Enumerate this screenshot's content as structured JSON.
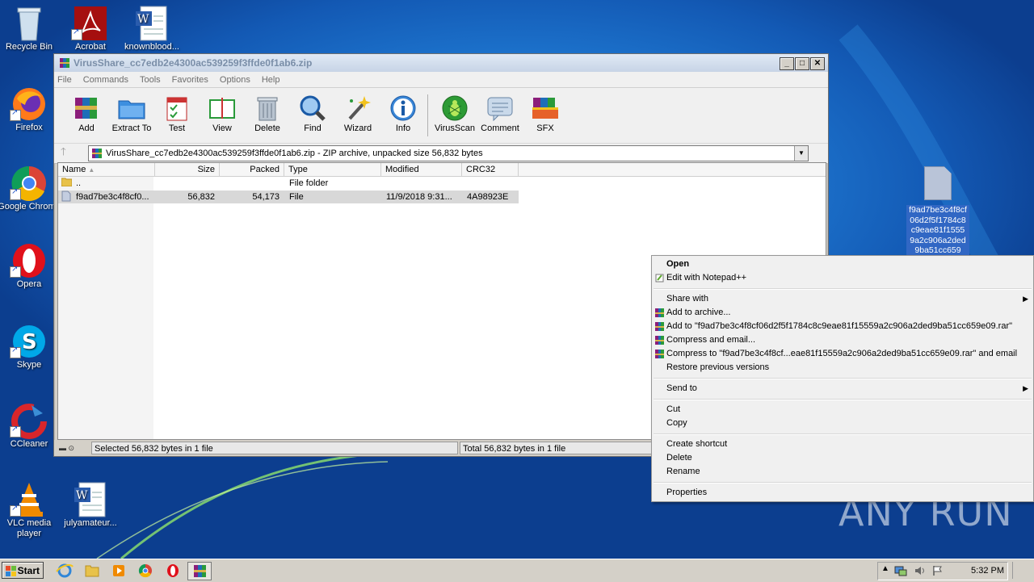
{
  "desktop": {
    "icons": [
      {
        "label": "Recycle Bin"
      },
      {
        "label": "Acrobat"
      },
      {
        "label": "knownblood..."
      },
      {
        "label": "Firefox"
      },
      {
        "label": "Google Chrome"
      },
      {
        "label": "Opera"
      },
      {
        "label": "Skype"
      },
      {
        "label": "CCleaner"
      },
      {
        "label": "VLC media player"
      },
      {
        "label": "julyamateur..."
      }
    ],
    "file_icon_name": "f9ad7be3c4f8cf06d2f5f1784c8c9eae81f15559a2c906a2ded9ba51cc659"
  },
  "window": {
    "title": "VirusShare_cc7edb2e4300ac539259f3ffde0f1ab6.zip",
    "menu": [
      "File",
      "Commands",
      "Tools",
      "Favorites",
      "Options",
      "Help"
    ],
    "toolbar": [
      "Add",
      "Extract To",
      "Test",
      "View",
      "Delete",
      "Find",
      "Wizard",
      "Info",
      "VirusScan",
      "Comment",
      "SFX"
    ],
    "address": "VirusShare_cc7edb2e4300ac539259f3ffde0f1ab6.zip - ZIP archive, unpacked size 56,832 bytes",
    "columns": [
      "Name",
      "Size",
      "Packed",
      "Type",
      "Modified",
      "CRC32"
    ],
    "rows": [
      {
        "name": "..",
        "size": "",
        "packed": "",
        "type": "File folder",
        "modified": "",
        "crc": ""
      },
      {
        "name": "f9ad7be3c4f8cf0...",
        "size": "56,832",
        "packed": "54,173",
        "type": "File",
        "modified": "11/9/2018 9:31...",
        "crc": "4A98923E"
      }
    ],
    "status_left": "Selected 56,832 bytes in 1 file",
    "status_right": "Total 56,832 bytes in 1 file"
  },
  "context_menu": {
    "open": "Open",
    "edit_npp": "Edit with Notepad++",
    "share_with": "Share with",
    "add_archive": "Add to archive...",
    "add_to_rar": "Add to \"f9ad7be3c4f8cf06d2f5f1784c8c9eae81f15559a2c906a2ded9ba51cc659e09.rar\"",
    "compress_email": "Compress and email...",
    "compress_rar_email": "Compress to \"f9ad7be3c4f8cf...eae81f15559a2c906a2ded9ba51cc659e09.rar\" and email",
    "restore": "Restore previous versions",
    "send_to": "Send to",
    "cut": "Cut",
    "copy": "Copy",
    "create_shortcut": "Create shortcut",
    "delete": "Delete",
    "rename": "Rename",
    "properties": "Properties"
  },
  "taskbar": {
    "start": "Start",
    "clock": "5:32 PM"
  },
  "watermark": "ANY RUN",
  "colors": {
    "desktop": "#1f7ad3",
    "selection": "#3167c4",
    "window": "#d4d0c8"
  }
}
